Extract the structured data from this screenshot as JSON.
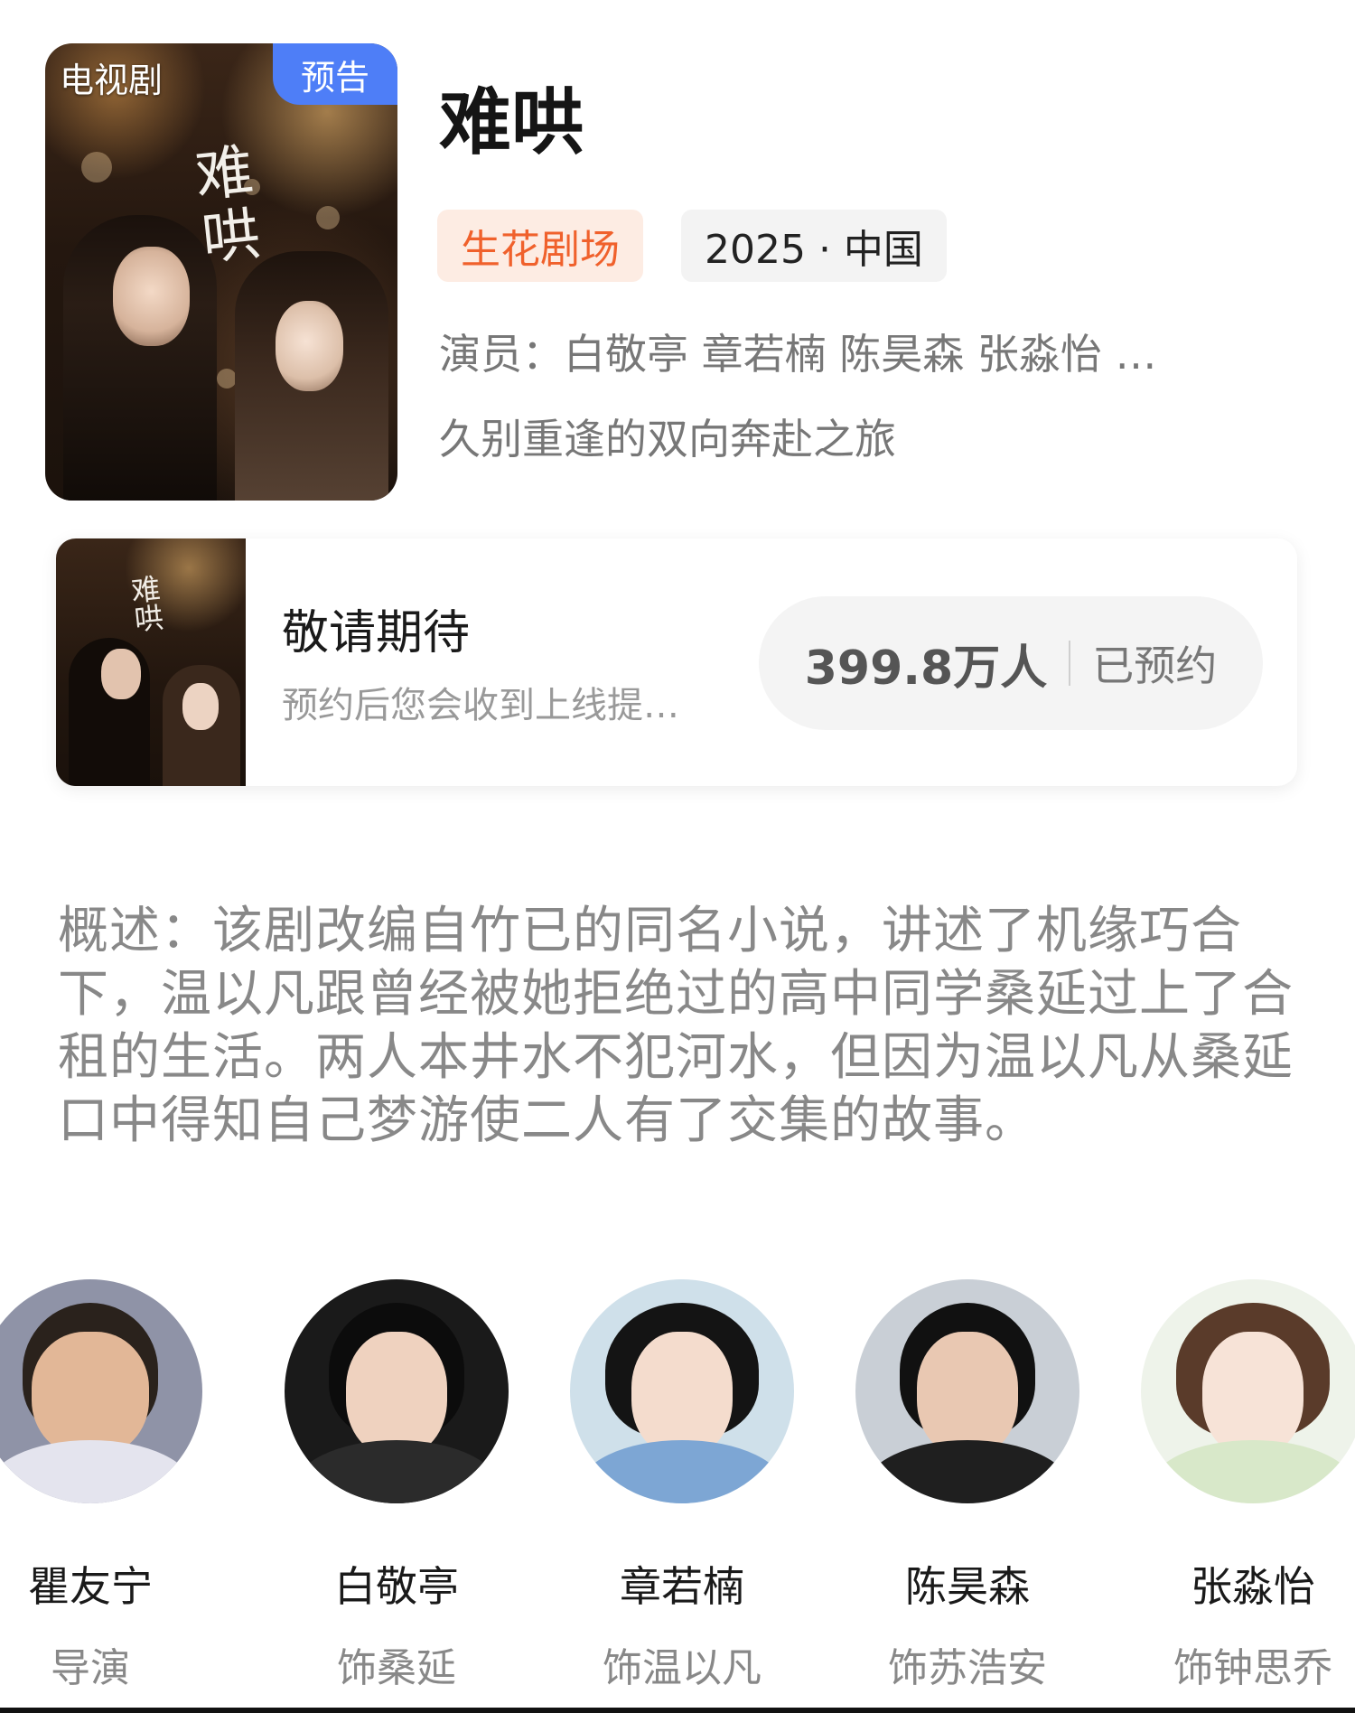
{
  "poster": {
    "type_tag": "电视剧",
    "badge": "预告",
    "calligraphy": "难哄"
  },
  "info": {
    "title": "难哄",
    "theater_tag": "生花剧场",
    "year_region": "2025 · 中国",
    "cast_line": "演员：白敬亭 章若楠 陈昊森  张淼怡 …",
    "tagline": "久别重逢的双向奔赴之旅"
  },
  "reservation": {
    "title": "敬请期待",
    "description": "预约后您会收到上线提…",
    "count": "399.8万人",
    "label": "已预约"
  },
  "summary": {
    "text": "概述：该剧改编自竹已的同名小说，讲述了机缘巧合下，温以凡跟曾经被她拒绝过的高中同学桑延过上了合租的生活。两人本井水不犯河水，但因为温以凡从桑延口中得知自己梦游使二人有了交集的故事。"
  },
  "cast": [
    {
      "name": "瞿友宁",
      "role": "导演"
    },
    {
      "name": "白敬亭",
      "role": "饰桑延"
    },
    {
      "name": "章若楠",
      "role": "饰温以凡"
    },
    {
      "name": "陈昊森",
      "role": "饰苏浩安"
    },
    {
      "name": "张淼怡",
      "role": "饰钟思乔"
    }
  ],
  "colors": {
    "badge_blue": "#4e7ef7",
    "theater_orange": "#f0612c",
    "theater_bg": "#fdece3"
  }
}
